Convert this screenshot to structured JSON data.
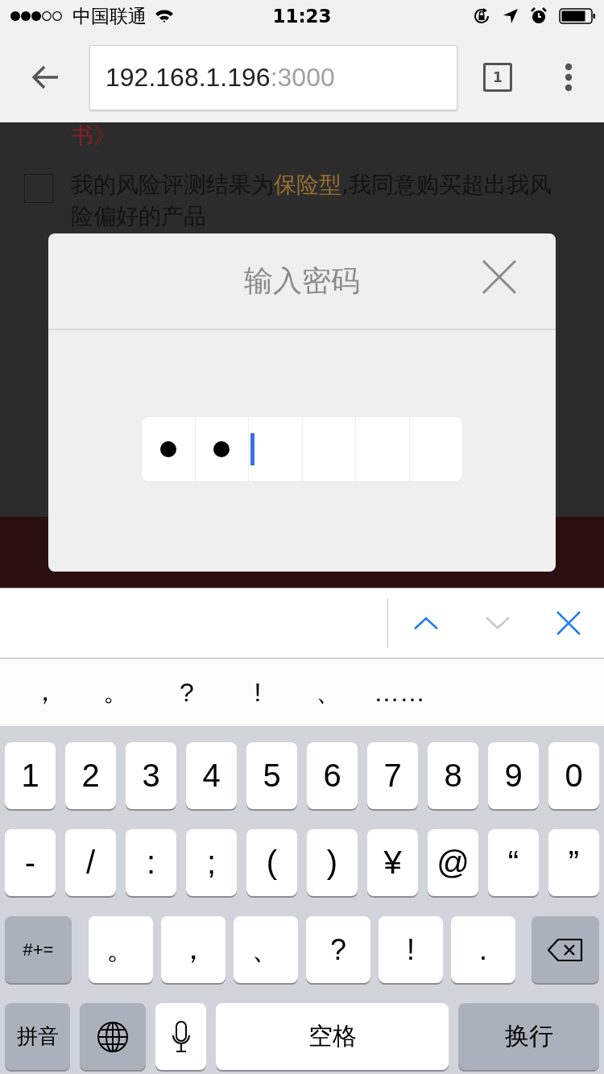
{
  "status_bar": {
    "carrier": "中国联通",
    "time": "11:23"
  },
  "browser": {
    "url_host": "192.168.1.196",
    "url_port": ":3000",
    "tab_count": "1"
  },
  "page": {
    "doc_tail": "书》",
    "agreement": {
      "checked": false,
      "parts": [
        {
          "kind": "plain",
          "text": "我的风险评测结果为"
        },
        {
          "kind": "highlight",
          "text": "保险型"
        },
        {
          "kind": "plain",
          "text": ",我同意购买超出我风险偏好的产品"
        }
      ]
    }
  },
  "dialog": {
    "title": "输入密码",
    "cells": [
      {
        "kind": "filled"
      },
      {
        "kind": "filled"
      },
      {
        "kind": "cursor"
      },
      {
        "kind": "empty"
      },
      {
        "kind": "empty"
      },
      {
        "kind": "empty"
      }
    ]
  },
  "keyboard_toolbar": {
    "previous_disabled": false,
    "next_disabled": true
  },
  "candidates": [
    "，",
    "。",
    "?",
    "!",
    "、",
    "……"
  ],
  "keyboard": {
    "number_row": [
      {
        "kind": "char",
        "label": "1"
      },
      {
        "kind": "char",
        "label": "2"
      },
      {
        "kind": "char",
        "label": "3"
      },
      {
        "kind": "char",
        "label": "4"
      },
      {
        "kind": "char",
        "label": "5"
      },
      {
        "kind": "char",
        "label": "6"
      },
      {
        "kind": "char",
        "label": "7"
      },
      {
        "kind": "char",
        "label": "8"
      },
      {
        "kind": "char",
        "label": "9"
      },
      {
        "kind": "char",
        "label": "0"
      }
    ],
    "symbol_row": [
      {
        "kind": "char",
        "label": "-"
      },
      {
        "kind": "char",
        "label": "/"
      },
      {
        "kind": "char",
        "label": ":"
      },
      {
        "kind": "char",
        "label": ";"
      },
      {
        "kind": "char",
        "label": "("
      },
      {
        "kind": "char",
        "label": ")"
      },
      {
        "kind": "char",
        "label": "¥"
      },
      {
        "kind": "char",
        "label": "@"
      },
      {
        "kind": "char",
        "label": "“"
      },
      {
        "kind": "char",
        "label": "”"
      }
    ],
    "punctuation_row": [
      {
        "kind": "symbols",
        "label": "#+="
      },
      {
        "kind": "punct",
        "label": "。"
      },
      {
        "kind": "punct",
        "label": "，"
      },
      {
        "kind": "punct",
        "label": "、"
      },
      {
        "kind": "punct",
        "label": "?"
      },
      {
        "kind": "punct",
        "label": "!"
      },
      {
        "kind": "punct",
        "label": "."
      },
      {
        "kind": "backspace"
      }
    ],
    "bottom_row": [
      {
        "kind": "mode",
        "label": "拼音"
      },
      {
        "kind": "globe"
      },
      {
        "kind": "mic"
      },
      {
        "kind": "space",
        "label": "空格"
      },
      {
        "kind": "return",
        "label": "换行"
      }
    ]
  }
}
